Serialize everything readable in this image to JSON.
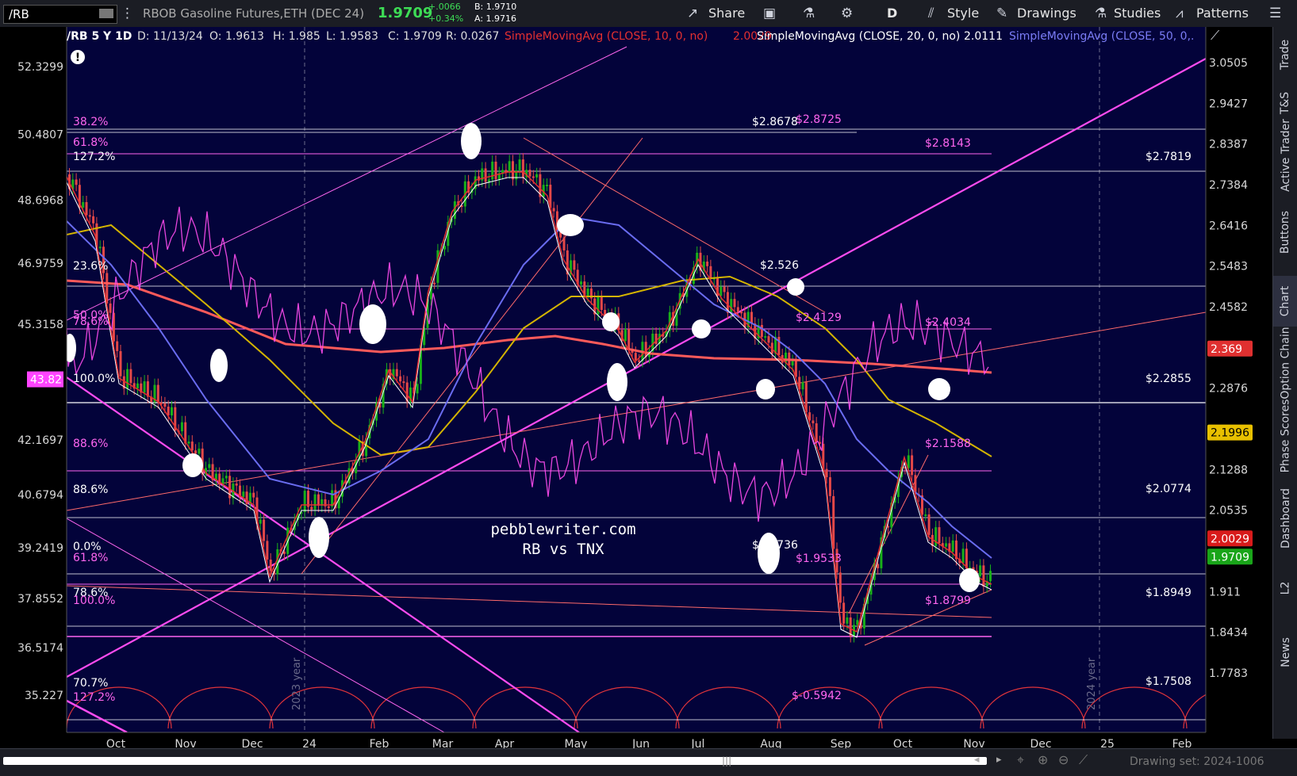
{
  "toolbar": {
    "symbol": "/RB",
    "instrument": "RBOB Gasoline Futures,ETH (DEC 24)",
    "last": "1.9709",
    "change_abs": "+.0066",
    "change_pct": "+0.34%",
    "bid": "B: 1.9710",
    "ask": "A: 1.9716",
    "share": "Share",
    "period": "D",
    "style": "Style",
    "drawings": "Drawings",
    "studies": "Studies",
    "patterns": "Patterns"
  },
  "header": {
    "symbol_agg": "/RB 5 Y 1D",
    "date": "D: 11/13/24",
    "open": "O: 1.9613",
    "high": "H: 1.985",
    "low": "L: 1.9583",
    "close": "C: 1.9709",
    "range": "R: 0.0267",
    "sma10_label": "SimpleMovingAvg (CLOSE, 10, 0, no)",
    "sma10_value": "2.0029",
    "sma20_label": "SimpleMovingAvg (CLOSE, 20, 0, no)",
    "sma20_value": "2.0111",
    "sma50_label": "SimpleMovingAvg (CLOSE, 50, 0,..."
  },
  "watermark": {
    "line1": "pebblewriter.com",
    "line2": "RB vs TNX"
  },
  "right_tabs": [
    "Trade",
    "T&S",
    "Active Trader",
    "Buttons",
    "Chart",
    "Option Chain",
    "Phase Scores",
    "Dashboard",
    "L2",
    "News"
  ],
  "bottom": {
    "drawing_set": "Drawing set: 2024-1006"
  },
  "chart_data": {
    "type": "line",
    "right_axis_ticks": [
      "3.0505",
      "2.9427",
      "2.8387",
      "2.7384",
      "2.6416",
      "2.5483",
      "2.4582",
      "2.369",
      "2.2876",
      "2.1996",
      "2.1288",
      "2.0535",
      "2.0029",
      "1.9709",
      "1.911",
      "1.8434",
      "1.7783"
    ],
    "left_axis_ticks": [
      "52.3299",
      "50.4807",
      "48.6968",
      "46.9759",
      "45.3158",
      "43.82",
      "42.1697",
      "40.6794",
      "39.2419",
      "37.8552",
      "36.5174",
      "35.227"
    ],
    "x_tick_labels": [
      "Oct",
      "Nov",
      "Dec",
      "24",
      "Feb",
      "Mar",
      "Apr",
      "May",
      "Jun",
      "Jul",
      "Aug",
      "Sep",
      "Oct",
      "Nov",
      "Dec",
      "25",
      "Feb"
    ],
    "year_markers": [
      "2023 year",
      "2024 year"
    ],
    "price_badges": [
      {
        "text": "2.369",
        "color": "#e03030"
      },
      {
        "text": "2.1996",
        "color": "#e8c000"
      },
      {
        "text": "2.0029",
        "color": "#d81b1b"
      },
      {
        "text": "1.9709",
        "color": "#19a519"
      }
    ],
    "left_badge": {
      "text": "43.82",
      "color": "#ff44ff"
    },
    "fib_labels": [
      "38.2%",
      "61.8%",
      "127.2%",
      "23.6%",
      "50.0%",
      "78.6%",
      "100.0%",
      "88.6%",
      "88.6%",
      "0.0%",
      "61.8%",
      "78.6%",
      "100.0%",
      "70.7%",
      "127.2%"
    ],
    "level_labels": [
      "$2.8678",
      "$2.8725",
      "$2.8143",
      "$2.7819",
      "$2.526",
      "$2.4129",
      "$2.4034",
      "$2.2855",
      "$2.1588",
      "$2.0774",
      "$1.9736",
      "$1.9533",
      "$1.8949",
      "$1.8799",
      "$1.7508",
      "$-0.5942"
    ],
    "series": [
      {
        "name": "SimpleMovingAvg (CLOSE, 10, 0, no)",
        "color": "#e53030"
      },
      {
        "name": "SimpleMovingAvg (CLOSE, 20, 0, no)",
        "color": "#ffffff"
      },
      {
        "name": "SimpleMovingAvg (CLOSE, 50, 0,...",
        "color": "#6a6cf0"
      }
    ],
    "grid": false
  },
  "colors": {
    "chart_bg": "#03033a",
    "up": "#19b019",
    "down": "#e44848",
    "magenta": "#ff4cf0",
    "accent_green": "#39d353"
  }
}
